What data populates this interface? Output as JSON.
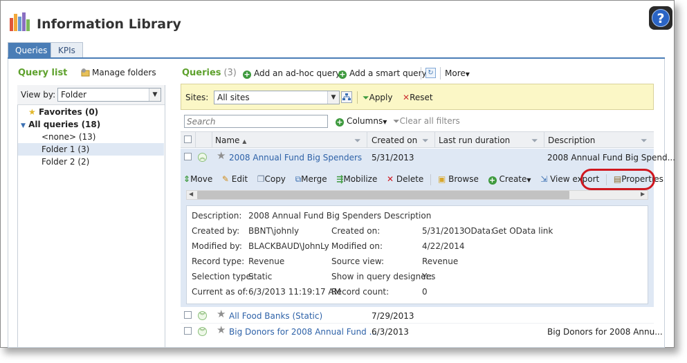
{
  "app": {
    "title": "Information Library",
    "help_label": "?"
  },
  "tabs": [
    {
      "label": "Queries",
      "active": true
    },
    {
      "label": "KPIs",
      "active": false
    }
  ],
  "sidebar": {
    "heading": "Query list",
    "manage_folders": "Manage folders",
    "view_by_label": "View by:",
    "view_by_value": "Folder",
    "tree": [
      {
        "label": "Favorites (0)"
      },
      {
        "label": "All queries (18)"
      },
      {
        "label": "<none> (13)"
      },
      {
        "label": "Folder 1 (3)",
        "selected": true
      },
      {
        "label": "Folder 2 (2)"
      }
    ]
  },
  "main": {
    "heading": "Queries",
    "count": "(3)",
    "toolbar": {
      "add_adhoc": "Add an ad-hoc query",
      "add_smart": "Add a smart query",
      "more": "More"
    },
    "filters": {
      "sites_label": "Sites:",
      "sites_value": "All sites",
      "apply": "Apply",
      "reset": "Reset"
    },
    "search": {
      "placeholder": "Search",
      "columns": "Columns",
      "clear_filters": "Clear all filters"
    },
    "columns": [
      "Name",
      "Created on",
      "Last run duration",
      "Description"
    ],
    "rows": [
      {
        "name": "2008 Annual Fund Big Spenders",
        "created": "5/31/2013",
        "duration": "",
        "description": "2008 Annual Fund Big Spend..."
      },
      {
        "name": "All Food Banks (Static)",
        "created": "7/29/2013",
        "duration": "",
        "description": ""
      },
      {
        "name": "Big Donors for 2008 Annual Fund ...",
        "created": "6/3/2013",
        "duration": "",
        "description": "Big Donors for 2008 Annu..."
      }
    ],
    "actions": [
      "Move",
      "Edit",
      "Copy",
      "Merge",
      "Mobilize",
      "Delete",
      "Browse",
      "Create",
      "View export",
      "Properties"
    ],
    "details": {
      "description_label": "Description:",
      "description_value": "2008 Annual Fund Big Spenders Description",
      "created_by_label": "Created by:",
      "created_by_value": "BBNT\\johnly",
      "created_on_label": "Created on:",
      "created_on_value": "5/31/2013",
      "odata_label": "OData:",
      "odata_link": "Get OData link",
      "modified_by_label": "Modified by:",
      "modified_by_value": "BLACKBAUD\\JohnLy",
      "modified_on_label": "Modified on:",
      "modified_on_value": "4/22/2014",
      "record_type_label": "Record type:",
      "record_type_value": "Revenue",
      "source_view_label": "Source view:",
      "source_view_value": "Revenue",
      "selection_type_label": "Selection type:",
      "selection_type_value": "Static",
      "show_designer_label": "Show in query designer:",
      "show_designer_value": "Yes",
      "current_as_of_label": "Current as of:",
      "current_as_of_value": "6/3/2013 11:19:17 AM",
      "record_count_label": "Record count:",
      "record_count_value": "0"
    }
  },
  "colors": {
    "accent": "#4a7db6",
    "highlight_oval": "#d0171f",
    "filter_bar": "#fbf7c6",
    "selected_row": "#dfe8f4"
  }
}
